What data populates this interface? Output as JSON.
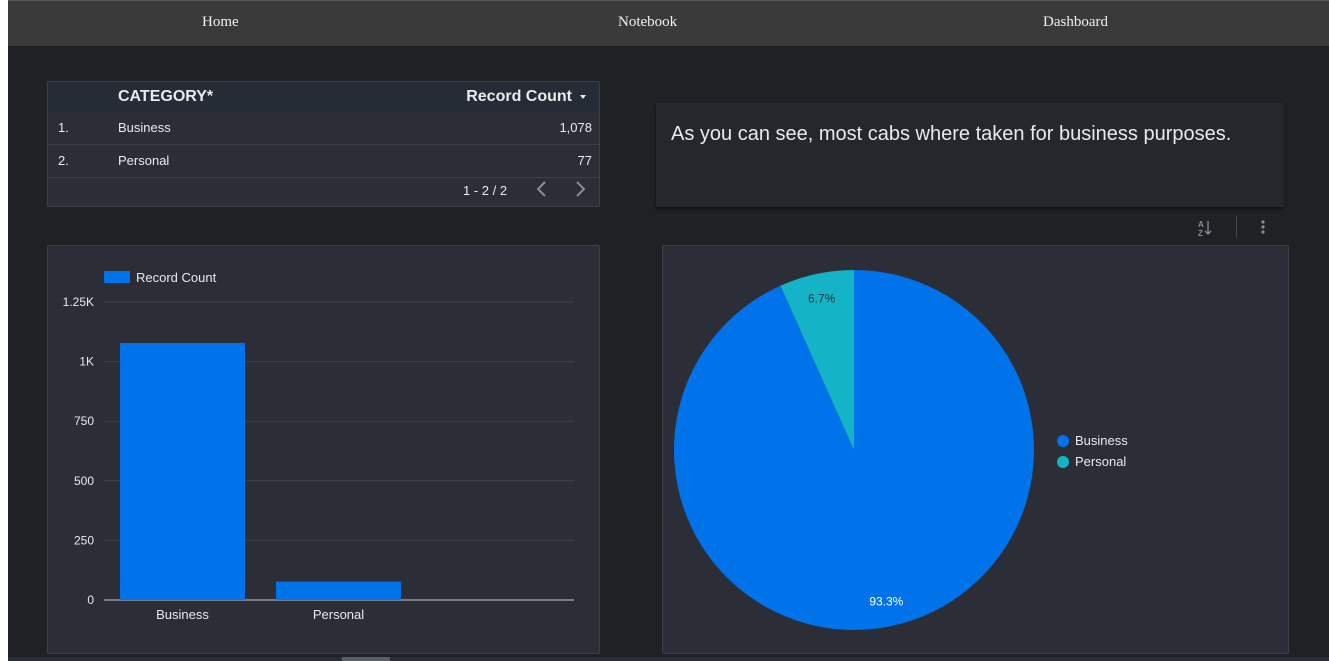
{
  "nav": {
    "home": "Home",
    "notebook": "Notebook",
    "dashboard": "Dashboard"
  },
  "table": {
    "col_category": "CATEGORY*",
    "col_count": "Record Count",
    "rows": [
      {
        "index": "1.",
        "category": "Business",
        "count": "1,078"
      },
      {
        "index": "2.",
        "category": "Personal",
        "count": "77"
      }
    ],
    "pager": "1 - 2 / 2"
  },
  "text_box": {
    "message": "As you can see, most cabs where taken for business purposes."
  },
  "toolbar": {
    "sort_icon": "sort-az-icon",
    "more_icon": "more-vert-icon"
  },
  "colors": {
    "business": "#0073ea",
    "personal": "#14b3c6"
  },
  "chart_data": [
    {
      "type": "bar",
      "categories": [
        "Business",
        "Personal"
      ],
      "series": [
        {
          "name": "Record Count",
          "values": [
            1078,
            77
          ]
        }
      ],
      "ylim": [
        0,
        1250
      ],
      "yticks": [
        "0",
        "250",
        "500",
        "750",
        "1K",
        "1.25K"
      ],
      "ytick_values": [
        0,
        250,
        500,
        750,
        1000,
        1250
      ],
      "legend": "top-left",
      "grid": true
    },
    {
      "type": "pie",
      "categories": [
        "Business",
        "Personal"
      ],
      "values": [
        93.3,
        6.7
      ],
      "labels": [
        "93.3%",
        "6.7%"
      ],
      "legend": "right"
    }
  ]
}
